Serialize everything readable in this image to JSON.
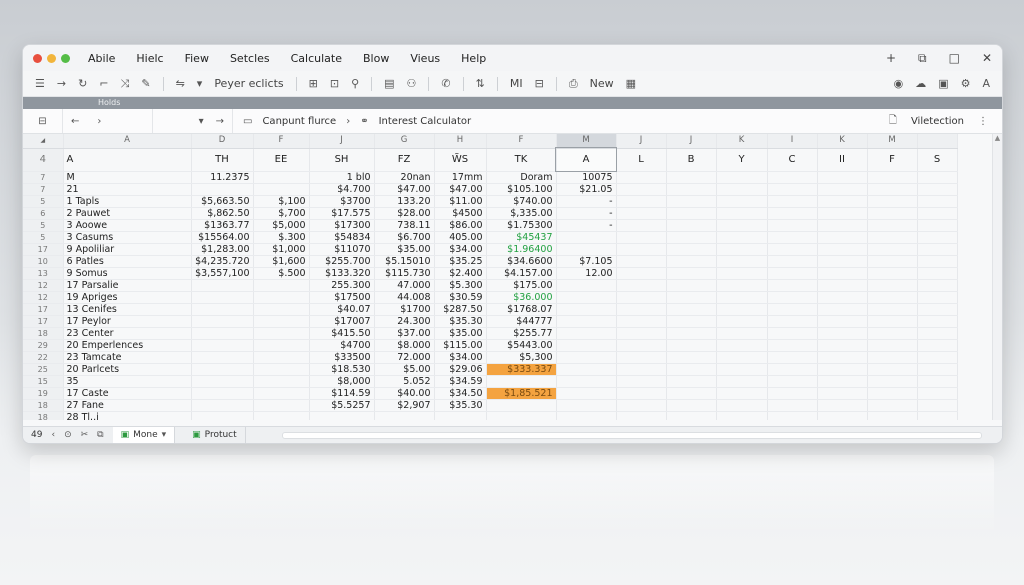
{
  "menu": [
    "Abile",
    "Hielc",
    "Fiew",
    "Setcles",
    "Calculate",
    "Blow",
    "Vieus",
    "Help"
  ],
  "window_controls": [
    "+",
    "⧉",
    "□",
    "✕"
  ],
  "toolbar": {
    "font_name": "Peyer eclicts",
    "new_label": "New",
    "mi_label": "MI"
  },
  "strip_label": "Holds",
  "nav": {
    "breadcrumb_1": "Canpunt flurce",
    "breadcrumb_2": "Interest Calculator",
    "right_label": "Viletection"
  },
  "columns": [
    "A",
    "D",
    "F",
    "J",
    "G",
    "H",
    "F",
    "M",
    "J",
    "J",
    "K",
    "I",
    "K",
    "M"
  ],
  "selected_column_index": 7,
  "header_row": {
    "rn": "4",
    "cells": [
      "A",
      "TH",
      "EE",
      "SH",
      "FZ",
      "W̃S",
      "TK",
      "A",
      "L",
      "B",
      "Y",
      "C",
      "II",
      "F",
      "S"
    ]
  },
  "rows": [
    {
      "rn": "7",
      "cells": [
        "M",
        "11.2375",
        "",
        "1 bl0",
        "20nan",
        "17mm",
        "Doram",
        "10075"
      ]
    },
    {
      "rn": "7",
      "cells": [
        "21",
        "",
        "",
        "$4.700",
        "$47.00",
        "$47.00",
        "$105.100",
        "$21.05"
      ]
    },
    {
      "rn": "5",
      "cells": [
        "1  Tapls",
        "$5,663.50",
        "$,100",
        "$3700",
        "133.20",
        "$11.00",
        "$740.00",
        "-"
      ]
    },
    {
      "rn": "6",
      "cells": [
        "2  Pauwet",
        "$,862.50",
        "$,700",
        "$17.575",
        "$28.00",
        "$4500",
        "$,335.00",
        "-"
      ]
    },
    {
      "rn": "5",
      "cells": [
        "3  Aoowe",
        "$1363.77",
        "$5,000",
        "$17300",
        "738.11",
        "$86.00",
        "$1.75300",
        "-"
      ]
    },
    {
      "rn": "5",
      "cells": [
        "3  Casums",
        "$15564.00",
        "$.300",
        "$54834",
        "$6.700",
        "405.00",
        "$45437",
        ""
      ]
    },
    {
      "rn": "17",
      "cells": [
        "9  Apoliliar",
        "$1,283.00",
        "$1,000",
        "$11070",
        "$35.00",
        "$34.00",
        "$1.96400",
        ""
      ]
    },
    {
      "rn": "10",
      "cells": [
        "6  Patles",
        "$4,235.720",
        "$1,600",
        "$255.700",
        "$5.15010",
        "$35.25",
        "$34.6600",
        "$7.105"
      ]
    },
    {
      "rn": "13",
      "cells": [
        "9  Somus",
        "$3,557,100",
        "$.500",
        "$133.320",
        "$115.730",
        "$2.400",
        "$4.157.00",
        "12.00"
      ]
    },
    {
      "rn": "12",
      "cells": [
        "17  Parsalie",
        "",
        "",
        "255.300",
        "47.000",
        "$5.300",
        "$175.00",
        ""
      ]
    },
    {
      "rn": "12",
      "cells": [
        "19  Apriges",
        "",
        "",
        "$17500",
        "44.008",
        "$30.59",
        "$36.000",
        ""
      ]
    },
    {
      "rn": "17",
      "cells": [
        "13  Cenifes",
        "",
        "",
        "$40.07",
        "$1700",
        "$287.50",
        "$1768.07",
        ""
      ]
    },
    {
      "rn": "17",
      "cells": [
        "17  Peylor",
        "",
        "",
        "$17007",
        "24.300",
        "$35.30",
        "$44777",
        ""
      ]
    },
    {
      "rn": "18",
      "cells": [
        "23  Center",
        "",
        "",
        "$415.50",
        "$37.00",
        "$35.00",
        "$255.77",
        ""
      ]
    },
    {
      "rn": "29",
      "cells": [
        "20  Emperlences",
        "",
        "",
        "$4700",
        "$8.000",
        "$115.00",
        "$5443.00",
        ""
      ]
    },
    {
      "rn": "22",
      "cells": [
        "23  Tamcate",
        "",
        "",
        "$33500",
        "72.000",
        "$34.00",
        "$5,300",
        ""
      ]
    },
    {
      "rn": "25",
      "cells": [
        "20  Parlcets",
        "",
        "",
        "$18.530",
        "$5.00",
        "$29.06",
        "$333.337",
        ""
      ]
    },
    {
      "rn": "15",
      "cells": [
        "35",
        "",
        "",
        "$8,000",
        "5.052",
        "$34.59",
        "",
        ""
      ]
    },
    {
      "rn": "19",
      "cells": [
        "17  Caste",
        "",
        "",
        "$114.59",
        "$40.00",
        "$34.50",
        "$1,85.521",
        ""
      ]
    },
    {
      "rn": "18",
      "cells": [
        "27  Fane",
        "",
        "",
        "$5.5257",
        "$2,907",
        "$35.30",
        "",
        ""
      ]
    },
    {
      "rn": "18",
      "cells": [
        "28 Tl..i",
        "",
        "",
        "",
        "",
        "",
        "",
        ""
      ]
    }
  ],
  "green_cells": [
    "5-6",
    "6-6",
    "10-6"
  ],
  "orange_cells": [
    "16-6",
    "18-6"
  ],
  "status": {
    "row_a": "49",
    "tab_1": "Mone",
    "tab_2": "Protuct"
  }
}
